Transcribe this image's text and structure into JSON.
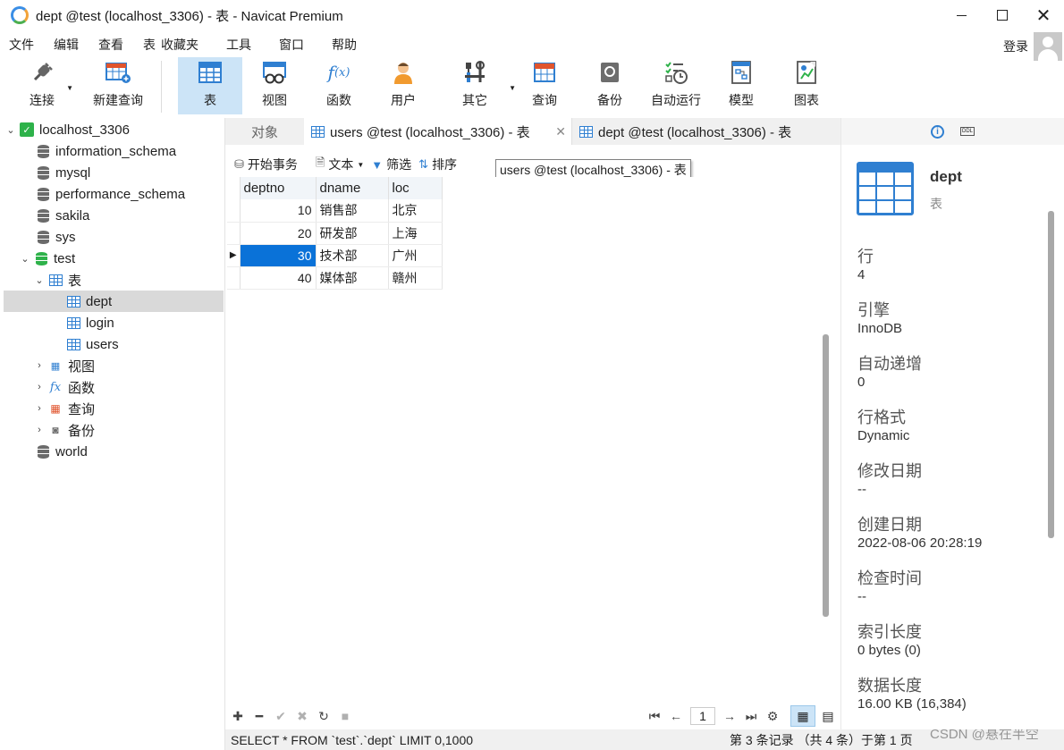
{
  "window": {
    "title": "dept @test (localhost_3306) - 表 - Navicat Premium"
  },
  "menu": [
    "文件",
    "编辑",
    "查看",
    "表",
    "收藏夹",
    "工具",
    "窗口",
    "帮助"
  ],
  "account": {
    "login_label": "登录"
  },
  "toolbar": {
    "connect": "连接",
    "new_query": "新建查询",
    "table": "表",
    "view": "视图",
    "function": "函数",
    "user": "用户",
    "other": "其它",
    "query": "查询",
    "backup": "备份",
    "automation": "自动运行",
    "model": "模型",
    "chart": "图表"
  },
  "tree": {
    "connection": "localhost_3306",
    "databases": [
      "information_schema",
      "mysql",
      "performance_schema",
      "sakila",
      "sys"
    ],
    "test_db": "test",
    "tables_folder": "表",
    "tables": [
      "dept",
      "login",
      "users"
    ],
    "folders": [
      "视图",
      "函数",
      "查询",
      "备份"
    ],
    "world_db": "world"
  },
  "tabs": {
    "objects": "对象",
    "tab1": "users @test (localhost_3306) - 表",
    "tab2": "dept @test (localhost_3306) - 表"
  },
  "data_toolbar": {
    "begin_transaction": "开始事务",
    "text": "文本",
    "filter": "筛选",
    "sort": "排序",
    "tooltip": "users @test (localhost_3306) - 表"
  },
  "grid": {
    "columns": [
      "deptno",
      "dname",
      "loc"
    ],
    "rows": [
      [
        "10",
        "销售部",
        "北京"
      ],
      [
        "20",
        "研发部",
        "上海"
      ],
      [
        "30",
        "技术部",
        "广州"
      ],
      [
        "40",
        "媒体部",
        "赣州"
      ]
    ],
    "selected_row": 2
  },
  "pager": {
    "page": "1"
  },
  "status": {
    "sql": "SELECT * FROM `test`.`dept` LIMIT 0,1000",
    "records": "第 3 条记录 （共 4 条）于第 1 页"
  },
  "watermark": "CSDN @悬在半空",
  "info_panel": {
    "name": "dept",
    "type": "表",
    "props": [
      {
        "label": "行",
        "value": "4"
      },
      {
        "label": "引擎",
        "value": "InnoDB"
      },
      {
        "label": "自动递增",
        "value": "0"
      },
      {
        "label": "行格式",
        "value": "Dynamic"
      },
      {
        "label": "修改日期",
        "value": "--"
      },
      {
        "label": "创建日期",
        "value": "2022-08-06 20:28:19"
      },
      {
        "label": "检查时间",
        "value": "--"
      },
      {
        "label": "索引长度",
        "value": "0 bytes (0)"
      },
      {
        "label": "数据长度",
        "value": "16.00 KB (16,384)"
      }
    ]
  },
  "colors": {
    "accent": "#0a72d8",
    "selected_tool": "#cce4f7",
    "icon_blue": "#2f7fd1",
    "db_green": "#2eb24a"
  }
}
